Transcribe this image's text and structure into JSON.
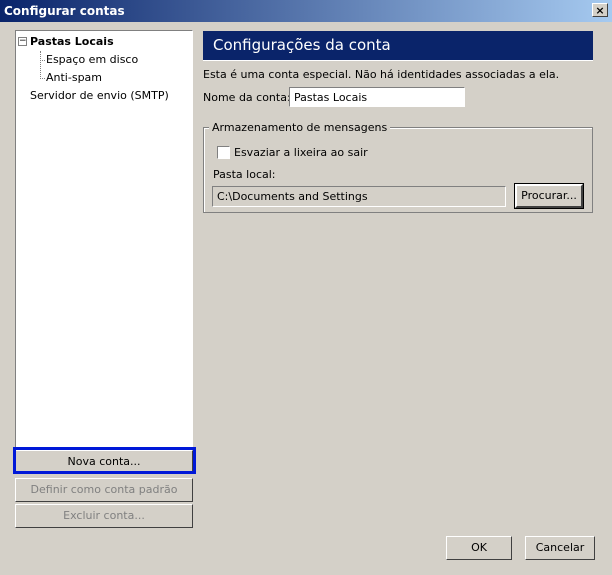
{
  "window": {
    "title": "Configurar contas",
    "close_label": "×"
  },
  "tree": {
    "expander": "−",
    "root": "Pastas Locais",
    "children": [
      "Espaço em disco",
      "Anti-spam"
    ],
    "smtp": "Servidor de envio (SMTP)"
  },
  "buttons": {
    "nova": "Nova conta...",
    "padrao": "Definir como conta padrão",
    "excluir": "Excluir conta...",
    "procurar": "Procurar...",
    "ok": "OK",
    "cancel": "Cancelar"
  },
  "panel": {
    "header": "Configurações da conta",
    "description": "Esta é uma conta especial. Não há identidades associadas a ela.",
    "name_label": "Nome da conta:",
    "name_value": "Pastas Locais",
    "group_title": "Armazenamento de mensagens",
    "checkbox_label": "Esvaziar a lixeira ao sair",
    "checkbox_checked": false,
    "folder_label": "Pasta local:",
    "folder_value": "C:\\Documents and Settings"
  }
}
